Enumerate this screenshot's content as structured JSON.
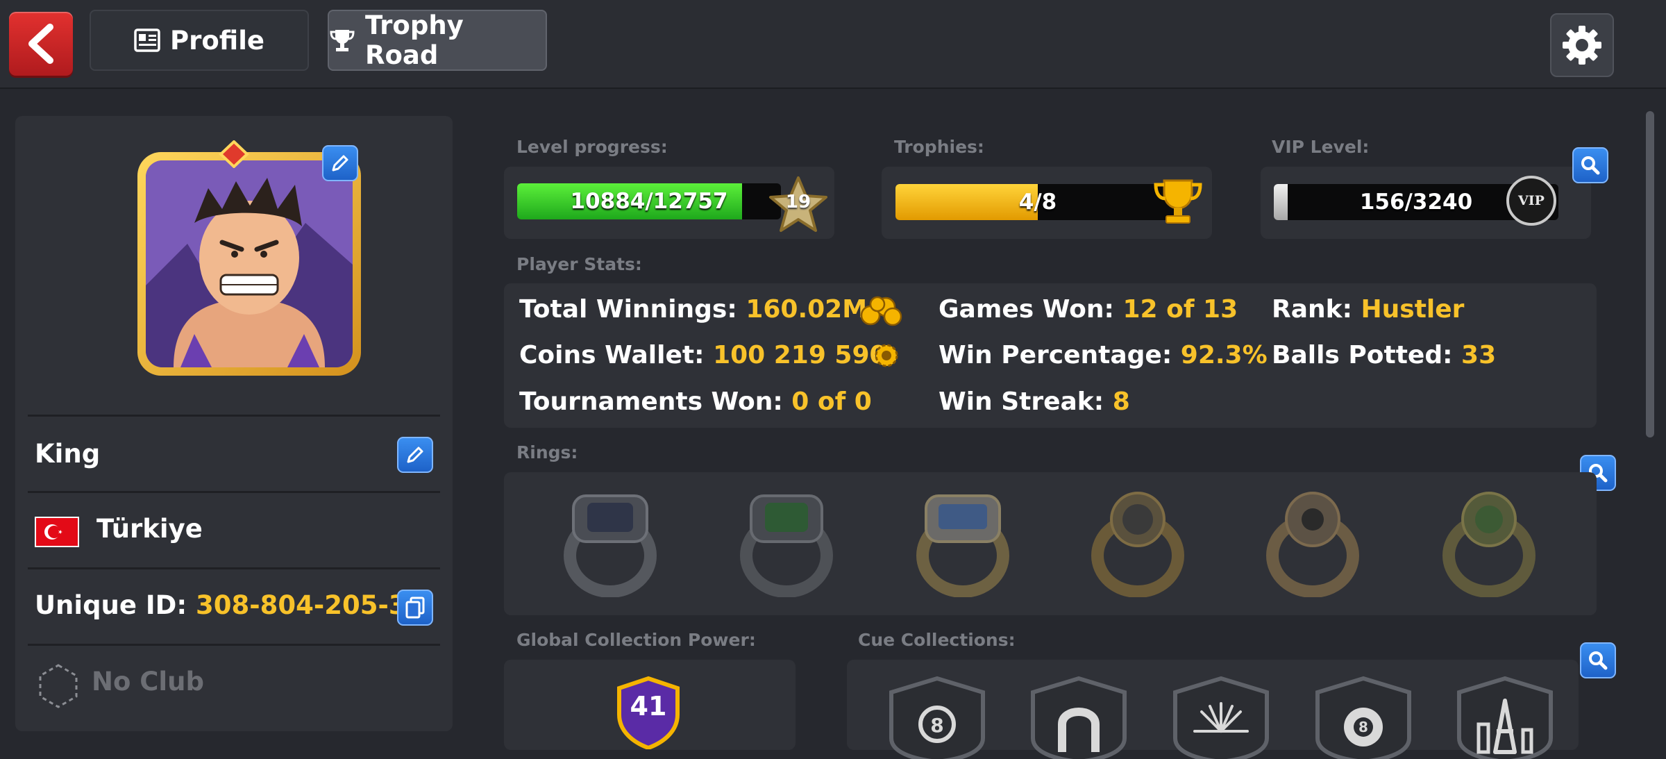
{
  "header": {
    "tabs": [
      {
        "label": "Profile"
      },
      {
        "label": "Trophy Road"
      }
    ]
  },
  "profile": {
    "name": "King",
    "country": "Türkiye",
    "unique_id_label": "Unique ID:",
    "unique_id": "308-804-205-3",
    "club": "No Club"
  },
  "progress": {
    "level_label": "Level progress:",
    "level_value": "10884/12757",
    "level_fraction": 0.853,
    "level_number": "19",
    "trophies_label": "Trophies:",
    "trophies_value": "4/8",
    "trophies_fraction": 0.5,
    "vip_label": "VIP Level:",
    "vip_value": "156/3240",
    "vip_fraction": 0.048,
    "vip_badge": "VIP"
  },
  "player_stats": {
    "label": "Player Stats:",
    "total_winnings_label": "Total Winnings:",
    "total_winnings": "160.02M",
    "coins_wallet_label": "Coins Wallet:",
    "coins_wallet": "100 219 590",
    "tournaments_won_label": "Tournaments Won:",
    "tournaments_won": "0 of 0",
    "games_won_label": "Games Won:",
    "games_won": "12 of 13",
    "win_percentage_label": "Win Percentage:",
    "win_percentage": "92.3%",
    "win_streak_label": "Win Streak:",
    "win_streak": "8",
    "rank_label": "Rank:",
    "rank": "Hustler",
    "balls_potted_label": "Balls Potted:",
    "balls_potted": "33"
  },
  "rings": {
    "label": "Rings:"
  },
  "collection": {
    "power_label": "Global Collection Power:",
    "power_value": "41",
    "cue_label": "Cue Collections:"
  },
  "colors": {
    "accent_yellow": "#f8c22a",
    "level_green": "#2ecc2e",
    "trophy_orange": "#f5b400",
    "button_blue": "#2a7ae0",
    "back_red": "#d42a2a"
  },
  "icons": [
    "back-arrow-icon",
    "profile-card-icon",
    "trophy-icon",
    "gear-icon",
    "pencil-icon",
    "turkey-flag-icon",
    "copy-icon",
    "club-hexagon-icon",
    "star-icon",
    "vip-badge-icon",
    "search-icon",
    "coins-icon",
    "coin-icon",
    "ring-icon",
    "cue-collection-shield-icon"
  ]
}
